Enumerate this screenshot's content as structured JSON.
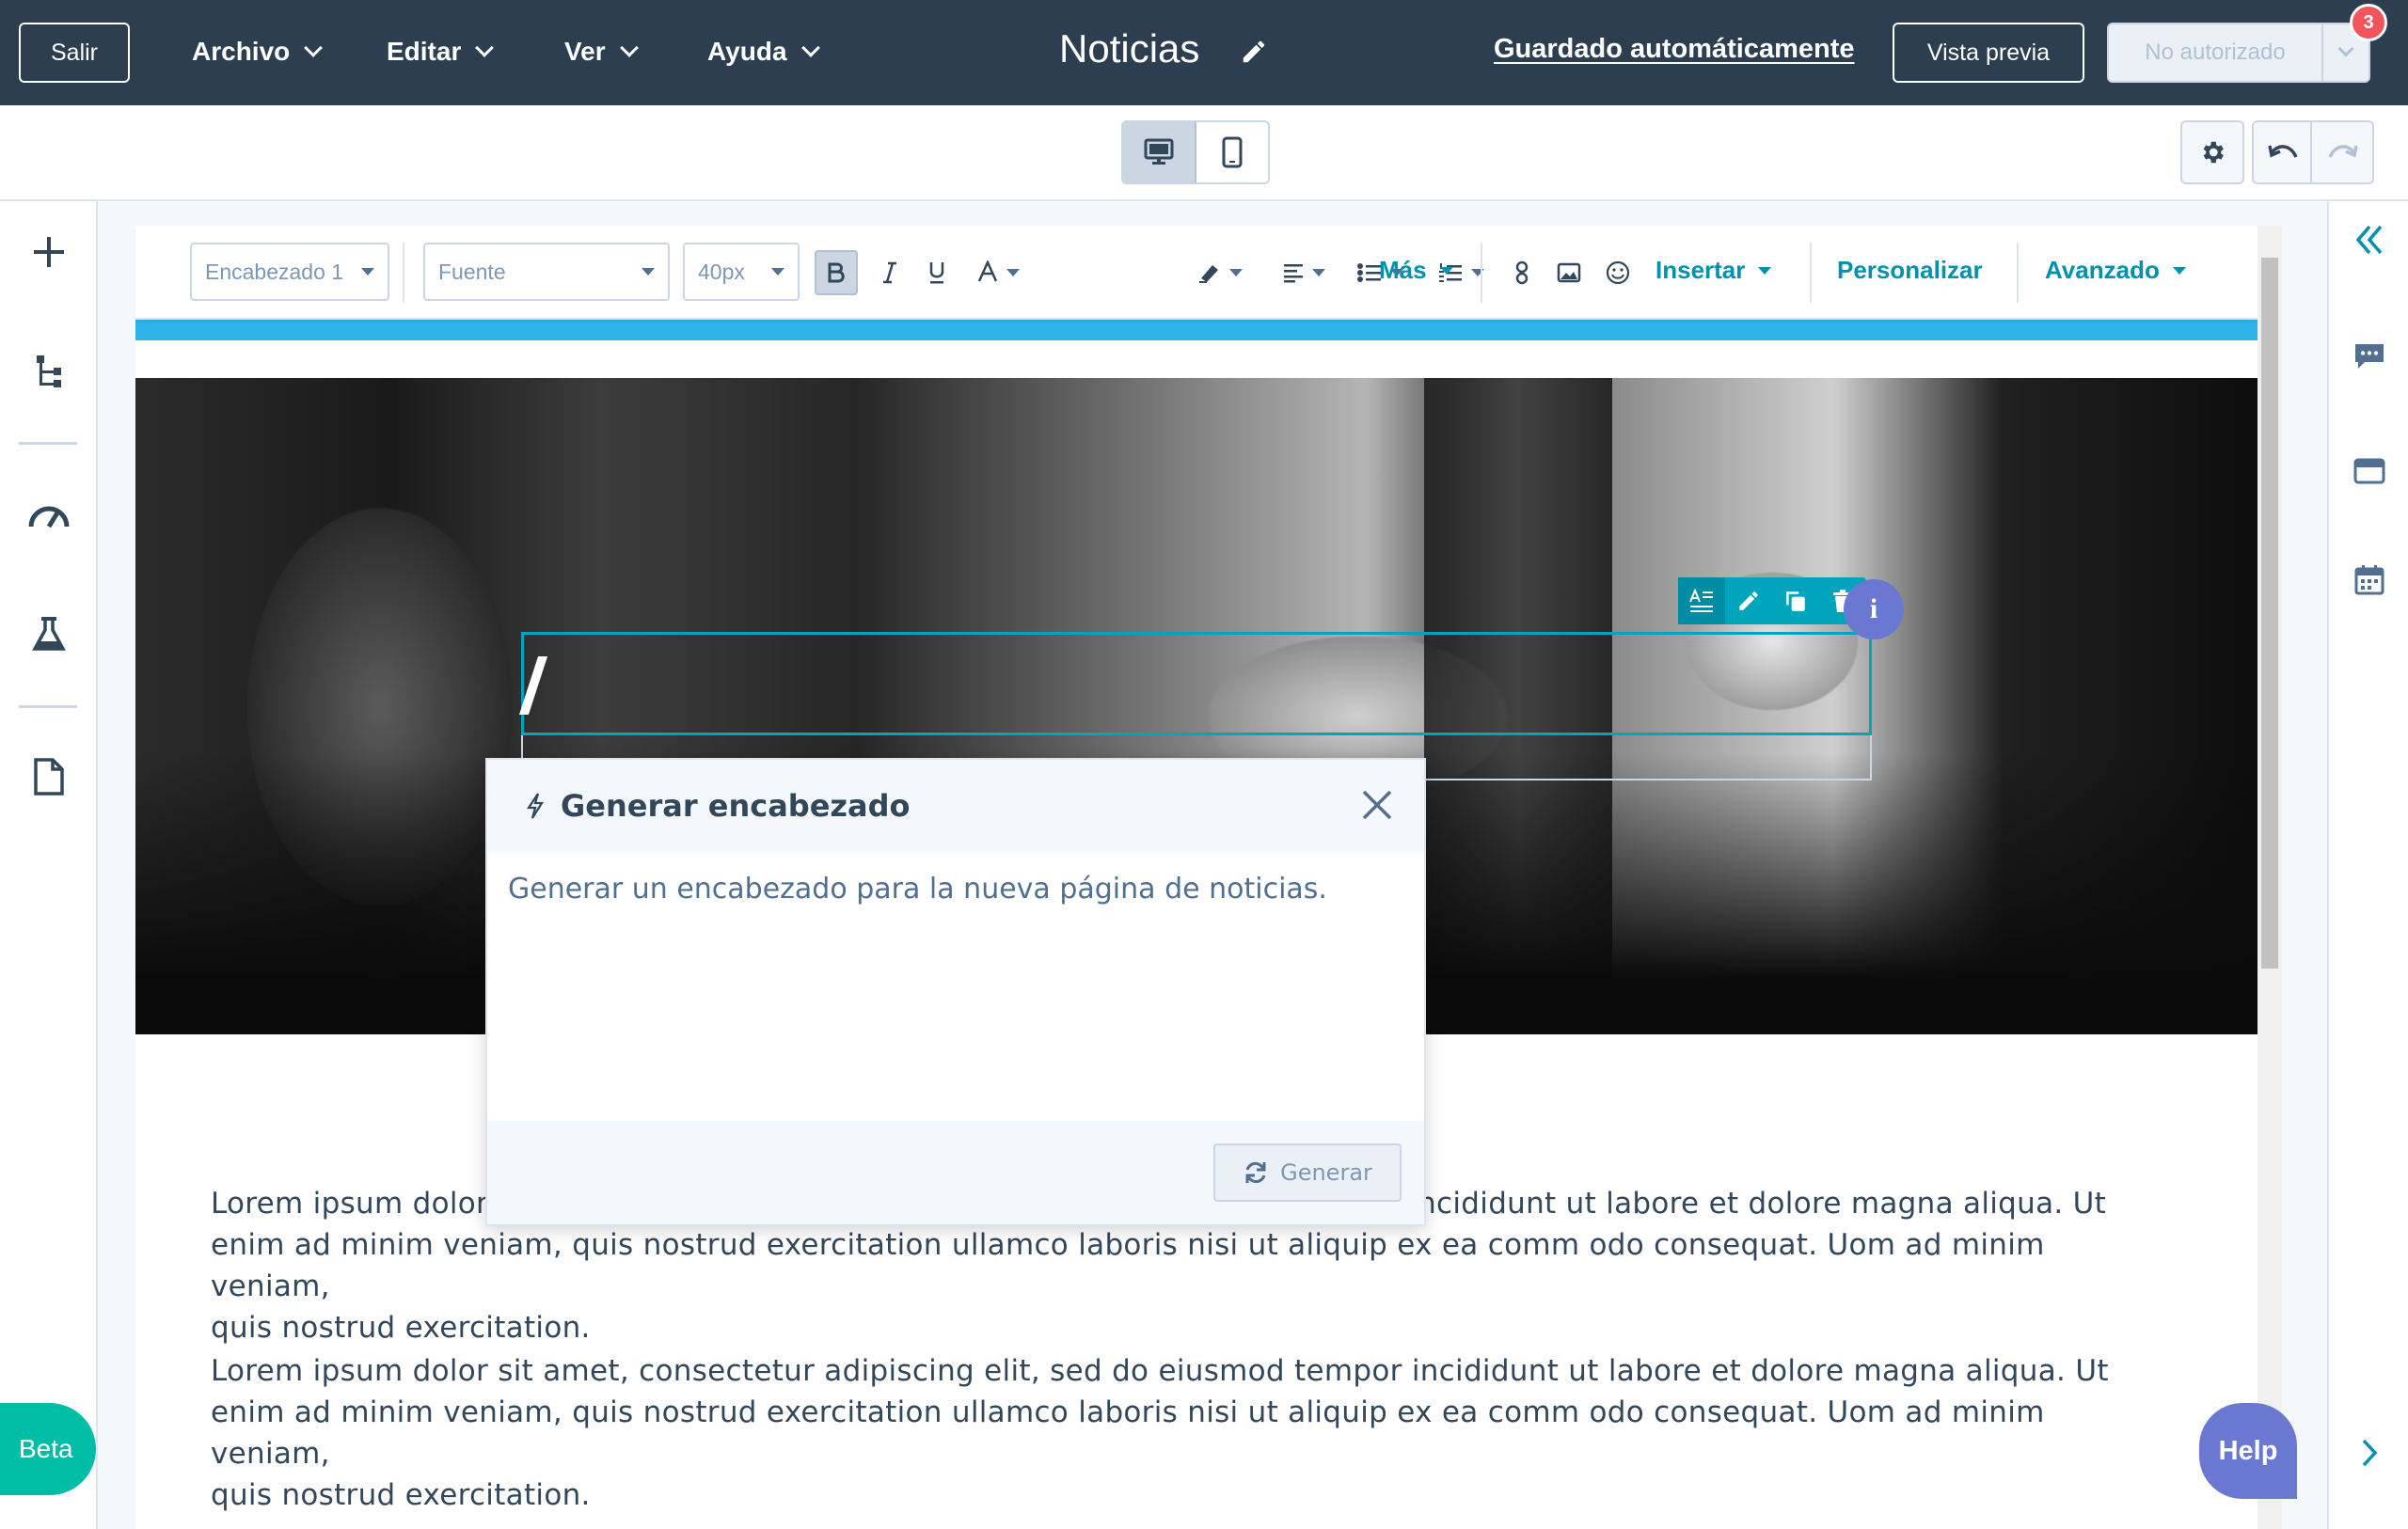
{
  "topnav": {
    "exit_label": "Salir",
    "menus": [
      "Archivo",
      "Editar",
      "Ver",
      "Ayuda"
    ],
    "title": "Noticias",
    "autosave": "Guardado automáticamente",
    "preview_label": "Vista previa",
    "publish_label": "No autorizado",
    "notification_count": "3"
  },
  "rte": {
    "block_style": "Encabezado 1",
    "font": "Fuente",
    "size": "40px",
    "more_label": "Más",
    "insert_label": "Insertar",
    "personalize_label": "Personalizar",
    "advanced_label": "Avanzado"
  },
  "module": {
    "info_label": "i"
  },
  "popup": {
    "title": "Generar encabezado",
    "prompt": "Generar un encabezado para la nueva página de noticias.",
    "generate_label": "Generar"
  },
  "content": {
    "paragraph1_line1": "Lorem ipsum dolor",
    "paragraph1_line1_end": "ncididunt ut labore et dolore magna aliqua. Ut",
    "paragraph1_line2": "enim ad minim veniam, quis nostrud exercitation ullamco laboris nisi ut aliquip ex ea comm odo consequat. Uom ad minim veniam,",
    "paragraph1_line3": "quis nostrud exercitation.",
    "paragraph2_line1": "Lorem ipsum dolor sit amet, consectetur adipiscing elit, sed do eiusmod tempor incididunt ut labore et dolore magna aliqua. Ut",
    "paragraph2_line2": "enim ad minim veniam, quis nostrud exercitation ullamco laboris nisi ut aliquip ex ea comm odo consequat. Uom ad minim veniam,",
    "paragraph2_line3": "quis nostrud exercitation."
  },
  "floating": {
    "beta_label": "Beta",
    "help_label": "Help"
  },
  "colors": {
    "nav_bg": "#2d3e50",
    "accent_teal": "#00a4bd",
    "banner_blue": "#2db3e6",
    "help_purple": "#6a78d1",
    "beta_green": "#00bda5",
    "badge_red": "#f2545b"
  }
}
